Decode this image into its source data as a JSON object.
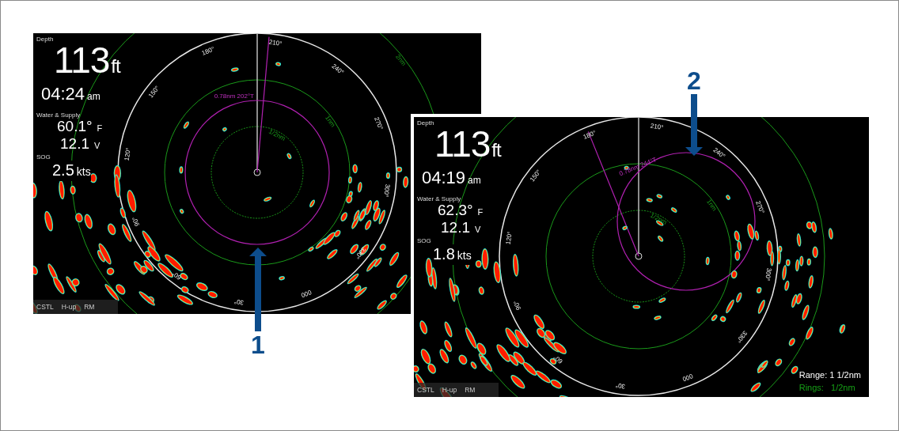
{
  "panels": [
    {
      "depth_label": "Depth",
      "depth_value": "113",
      "depth_unit": "ft",
      "time": "04:24",
      "time_suffix": "am",
      "water_label": "Water & Supply",
      "temperature": "60.1°",
      "temperature_unit": "F",
      "voltage": "12.1",
      "voltage_unit": "V",
      "sog_label": "SOG",
      "speed": "2.5",
      "speed_unit": "kts",
      "modes": [
        "CSTL",
        "H-up",
        "RM"
      ],
      "bearings": [
        "000",
        "30°",
        "60°",
        "90°",
        "120°",
        "150°",
        "180°",
        "210°",
        "240°",
        "270°",
        "300°",
        "330°"
      ],
      "vrm_label": "0.78nm  202°T",
      "ring_labels": [
        "1/2nm",
        "1nm",
        "2nm"
      ]
    },
    {
      "depth_label": "Depth",
      "depth_value": "113",
      "depth_unit": "ft",
      "time": "04:19",
      "time_suffix": "am",
      "water_label": "Water & Supply",
      "temperature": "62.3°",
      "temperature_unit": "F",
      "voltage": "12.1",
      "voltage_unit": "V",
      "sog_label": "SOG",
      "speed": "1.8",
      "speed_unit": "kts",
      "modes": [
        "CSTL",
        "H-up",
        "RM"
      ],
      "bearings": [
        "000",
        "30°",
        "60°",
        "90°",
        "120°",
        "150°",
        "180°",
        "210°",
        "240°",
        "270°",
        "300°",
        "330°"
      ],
      "vrm_label": "0.78nm  244°T",
      "ring_labels": [
        "1/2nm",
        "1nm"
      ],
      "range": "Range: 1 1/2nm",
      "rings": "Rings:   1/2nm"
    }
  ],
  "callouts": [
    "1",
    "2"
  ]
}
